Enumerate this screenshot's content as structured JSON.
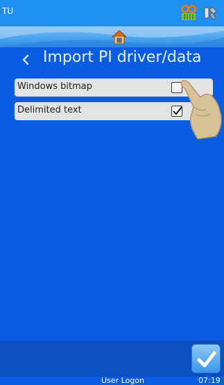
{
  "status": {
    "device": "TU",
    "user": "User Logon",
    "time": "07:19"
  },
  "icons": {
    "ribbon": "ribbon-cassette-icon",
    "tools": "tools-icon",
    "home": "home-icon",
    "back": "back-chevron-icon",
    "confirm": "check-icon"
  },
  "page": {
    "title": "Import PI driver/data"
  },
  "options": [
    {
      "label": "Windows bitmap",
      "checked": false
    },
    {
      "label": "Delimited text",
      "checked": true
    }
  ],
  "colors": {
    "background": "#0a5ce0",
    "top_bar": "#1f8ff0",
    "option_row": "#e3e3e3",
    "bottom_bar": "#0b4fc0"
  }
}
